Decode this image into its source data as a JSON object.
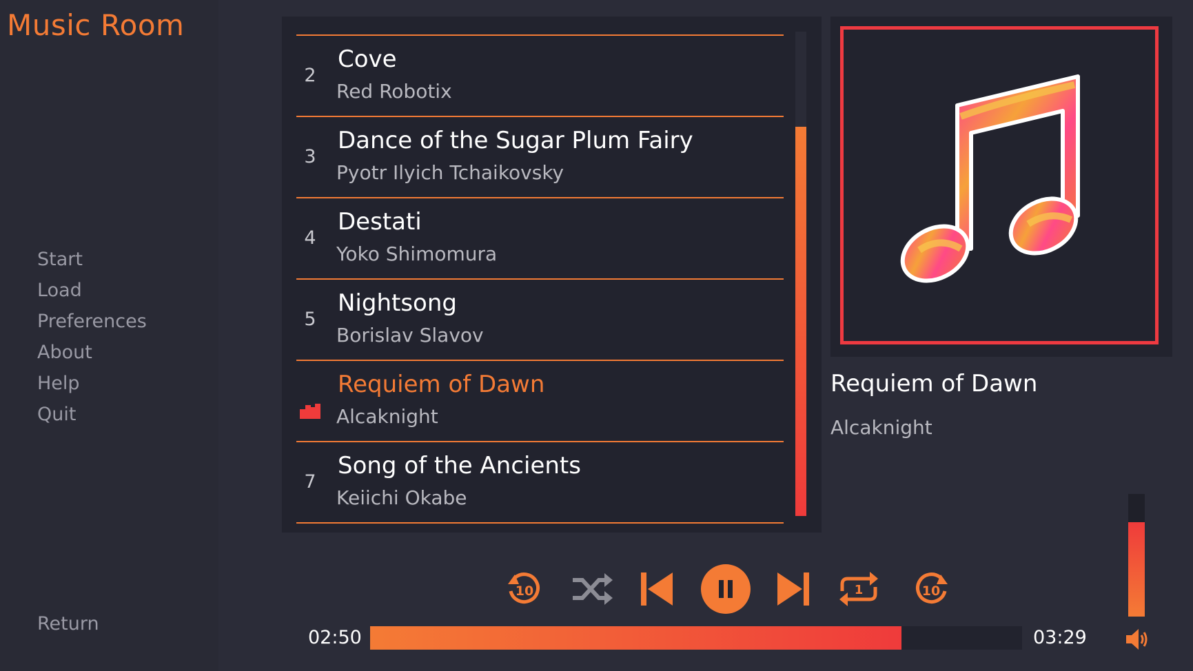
{
  "app": {
    "title": "Music Room"
  },
  "sidebar": {
    "items": [
      {
        "label": "Start"
      },
      {
        "label": "Load"
      },
      {
        "label": "Preferences"
      },
      {
        "label": "About"
      },
      {
        "label": "Help"
      },
      {
        "label": "Quit"
      }
    ],
    "return_label": "Return"
  },
  "playlist": {
    "tracks": [
      {
        "number": "2",
        "title": "Cove",
        "artist": "Red Robotix"
      },
      {
        "number": "3",
        "title": "Dance of the Sugar Plum Fairy",
        "artist": "Pyotr Ilyich Tchaikovsky"
      },
      {
        "number": "4",
        "title": "Destati",
        "artist": "Yoko Shimomura"
      },
      {
        "number": "5",
        "title": "Nightsong",
        "artist": "Borislav Slavov"
      },
      {
        "number": "",
        "title": "Requiem of Dawn",
        "artist": "Alcaknight",
        "playing": true,
        "icon": "equalizer-icon"
      },
      {
        "number": "7",
        "title": "Song of the Ancients",
        "artist": "Keiichi Okabe"
      }
    ],
    "scroll_position": 0.2
  },
  "now_playing": {
    "title": "Requiem of Dawn",
    "artist": "Alcaknight",
    "art_icon": "music-note-icon"
  },
  "player": {
    "current_time": "02:50",
    "total_time": "03:29",
    "progress": 0.815,
    "volume": 0.77,
    "controls": [
      {
        "name": "rewind-10-button",
        "icon": "rewind-10-icon",
        "label": "10"
      },
      {
        "name": "shuffle-button",
        "icon": "shuffle-icon"
      },
      {
        "name": "previous-button",
        "icon": "skip-previous-icon"
      },
      {
        "name": "pause-button",
        "icon": "pause-icon"
      },
      {
        "name": "next-button",
        "icon": "skip-next-icon"
      },
      {
        "name": "repeat-one-button",
        "icon": "repeat-one-icon",
        "label": "1"
      },
      {
        "name": "forward-10-button",
        "icon": "forward-10-icon",
        "label": "10"
      }
    ]
  },
  "colors": {
    "accent": "#f47b35",
    "accent_red": "#ef3b3b",
    "background": "#2b2c38",
    "panel": "#22232e",
    "text_muted": "#9a9aa5"
  }
}
